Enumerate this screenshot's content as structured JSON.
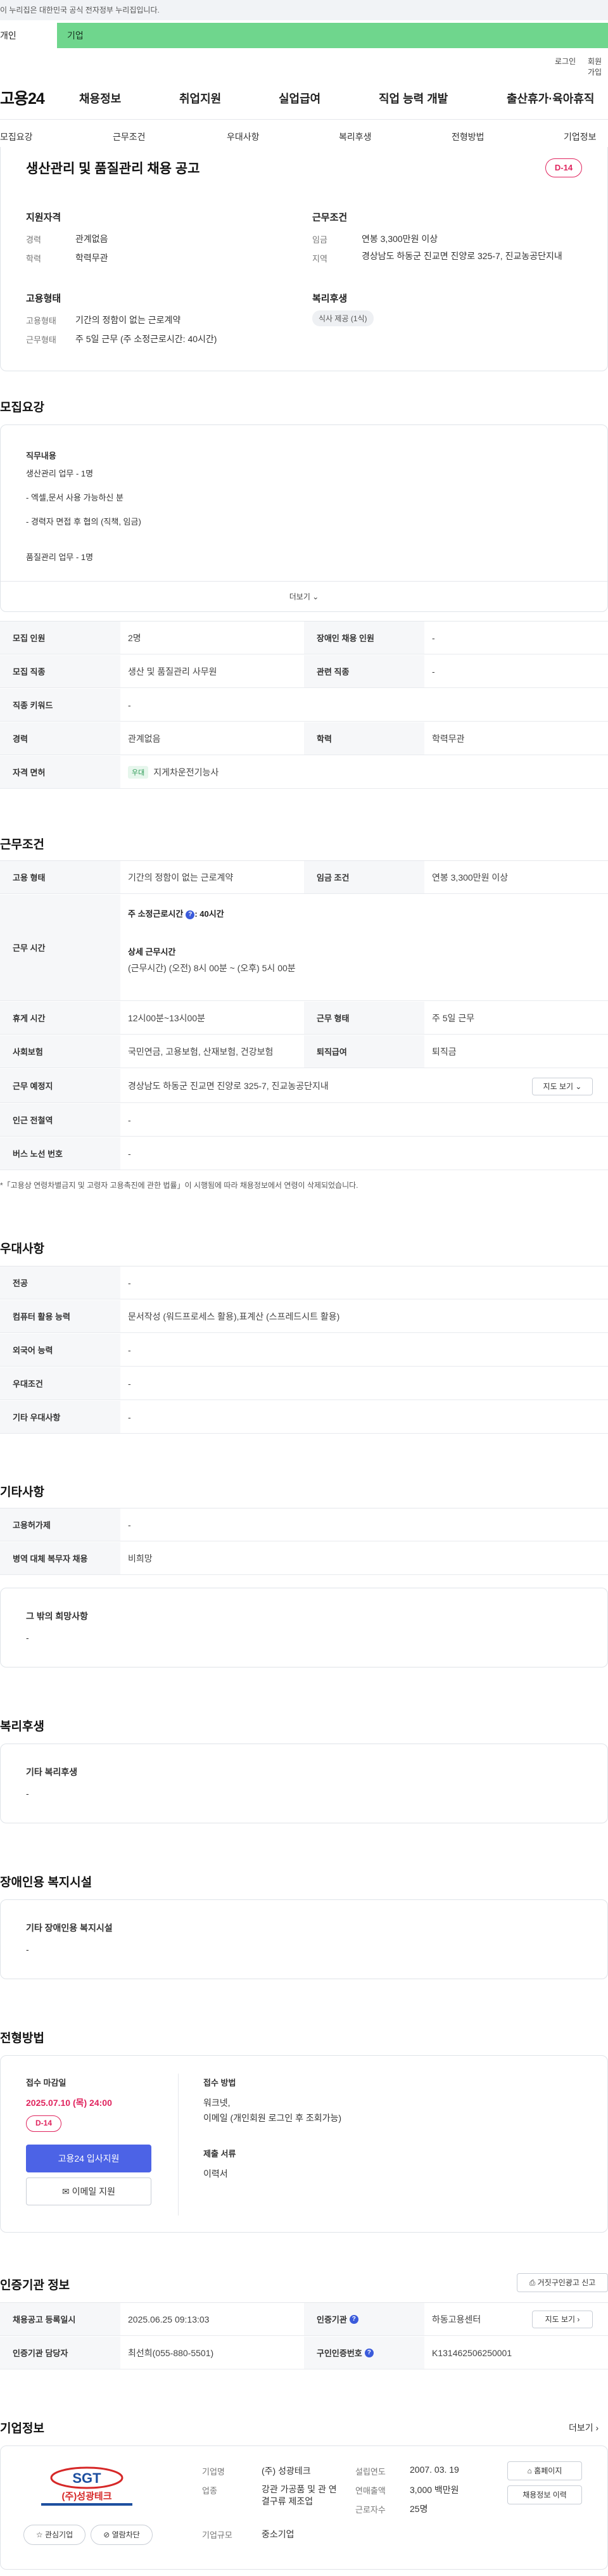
{
  "notice": "이 누리집은 대한민국 공식 전자정부 누리집입니다.",
  "switcher": {
    "individual": "개인",
    "business": "기업"
  },
  "util": {
    "login": "로그인",
    "signup": "회원가입"
  },
  "logo": "고용24",
  "gnb": [
    "채용정보",
    "취업지원",
    "실업급여",
    "직업 능력 개발",
    "출산휴가·육아휴직"
  ],
  "tabs": [
    "모집요강",
    "근무조건",
    "우대사항",
    "복리후생",
    "전형방법",
    "기업정보"
  ],
  "summary": {
    "title": "생산관리 및 품질관리 채용 공고",
    "dday": "D-14",
    "qual": {
      "heading": "지원자격",
      "career_k": "경력",
      "career_v": "관계없음",
      "edu_k": "학력",
      "edu_v": "학력무관"
    },
    "cond": {
      "heading": "근무조건",
      "wage_k": "임금",
      "wage_v": "연봉 3,300만원 이상",
      "loc_k": "지역",
      "loc_v": "경상남도 하동군 진교면 진양로 325-7, 진교농공단지내"
    },
    "emp": {
      "heading": "고용형태",
      "type_k": "고용형태",
      "type_v": "기간의 정함이 없는 근로계약",
      "work_k": "근무형태",
      "work_v": "주 5일 근무 (주 소정근로시간: 40시간)"
    },
    "welfare": {
      "heading": "복리후생",
      "chip": "식사 제공 (1식)"
    }
  },
  "recruit": {
    "heading": "모집요강",
    "duty_title": "직무내용",
    "duty_lines": [
      "생산관리 업무 - 1명",
      "- 엑셀,문서 사용 가능하신 분",
      "- 경력자 면접 후 협의 (직책, 임금)",
      "품질관리 업무 - 1명"
    ],
    "more": "더보기",
    "rows": [
      {
        "k1": "모집 인원",
        "v1": "2명",
        "k2": "장애인 채용 인원",
        "v2": "-"
      },
      {
        "k1": "모집 직종",
        "v1": "생산 및 품질관리 사무원",
        "k2": "관련 직종",
        "v2": "-"
      },
      {
        "k1": "직종 키워드",
        "v1": "-"
      },
      {
        "k1": "경력",
        "v1": "관계없음",
        "k2": "학력",
        "v2": "학력무관"
      },
      {
        "k1": "자격 면허",
        "tag": "우대",
        "v1": "지게차운전기능사"
      }
    ]
  },
  "work": {
    "heading": "근무조건",
    "emp_k": "고용 형태",
    "emp_v": "기간의 정함이 없는 근로계약",
    "wage_k": "임금 조건",
    "wage_v": "연봉 3,300만원 이상",
    "time_k": "근무 시간",
    "time_weekly": "주 소정근로시간",
    "time_weekly_v": ": 40시간",
    "time_detail_t": "상세 근무시간",
    "time_detail_v": "(근무시간) (오전) 8시 00분 ~ (오후) 5시 00분",
    "rest_k": "휴게 시간",
    "rest_v": "12시00분~13시00분",
    "form_k": "근무 형태",
    "form_v": "주 5일 근무",
    "ins_k": "사회보험",
    "ins_v": "국민연금, 고용보험, 산재보험, 건강보험",
    "sev_k": "퇴직급여",
    "sev_v": "퇴직금",
    "place_k": "근무 예정지",
    "place_v": "경상남도 하동군 진교면 진양로 325-7, 진교농공단지내",
    "map_btn": "지도 보기",
    "subway_k": "인근 전철역",
    "subway_v": "-",
    "bus_k": "버스 노선 번호",
    "bus_v": "-",
    "footnote": "*「고용상 연령차별금지 및 고령자 고용촉진에 관한 법률」이 시행됨에 따라 채용정보에서 연령이 삭제되었습니다."
  },
  "pref": {
    "heading": "우대사항",
    "rows": [
      {
        "k": "전공",
        "v": "-"
      },
      {
        "k": "컴퓨터 활용 능력",
        "v": "문서작성 (워드프로세스 활용),표계산 (스프레드시트 활용)"
      },
      {
        "k": "외국어 능력",
        "v": "-"
      },
      {
        "k": "우대조건",
        "v": "-"
      },
      {
        "k": "기타 우대사항",
        "v": "-"
      }
    ]
  },
  "etc": {
    "heading": "기타사항",
    "rows": [
      {
        "k": "고용허가제",
        "v": "-"
      },
      {
        "k": "병역 대체 복무자 채용",
        "v": "비희망"
      }
    ],
    "box_title": "그 밖의 희망사항",
    "box_v": "-"
  },
  "welfare": {
    "heading": "복리후생",
    "box_title": "기타 복리후생",
    "box_v": "-"
  },
  "disabled": {
    "heading": "장애인용 복지시설",
    "box_title": "기타 장애인용 복지시설",
    "box_v": "-"
  },
  "process": {
    "heading": "전형방법",
    "deadline_t": "접수 마감일",
    "deadline_v": "2025.07.10 (목) 24:00",
    "dday": "D-14",
    "apply_btn": "고용24 입사지원",
    "email_btn": "이메일 지원",
    "method_t": "접수 방법",
    "method_v1": "워크넷,",
    "method_v2": "이메일 (개인회원 로그인 후 조회가능)",
    "docs_t": "제출 서류",
    "docs_v": "이력서"
  },
  "agency": {
    "heading": "인증기관 정보",
    "report_btn": "거짓구인광고 신고",
    "reg_k": "채용공고 등록일시",
    "reg_v": "2025.06.25 09:13:03",
    "org_k": "인증기관",
    "org_v": "하동고용센터",
    "map_btn": "지도 보기",
    "mgr_k": "인증기관 담당자",
    "mgr_v": "최선희(055-880-5501)",
    "num_k": "구인인증번호",
    "num_v": "K131462506250001"
  },
  "company": {
    "heading": "기업정보",
    "more": "더보기",
    "logo_text": "SGT",
    "logo_sub": "(주)성광테크",
    "fav_btn": "관심기업",
    "block_btn": "열람차단",
    "name_k": "기업명",
    "name_v": "(주) 성광테크",
    "est_k": "설립연도",
    "est_v": "2007. 03. 19",
    "ind_k": "업종",
    "ind_v": "강관 가공품 및 관 연결구류 제조업",
    "sales_k": "연매출액",
    "sales_v": "3,000 백만원",
    "emp_k": "근로자수",
    "emp_v": "25명",
    "size_k": "기업규모",
    "size_v": "중소기업",
    "home_btn": "홈페이지",
    "jobs_btn": "채용정보 이력"
  },
  "colors": {
    "green": "#6fd68d",
    "accent": "#3b5bdb",
    "dday": "#e0245e"
  }
}
